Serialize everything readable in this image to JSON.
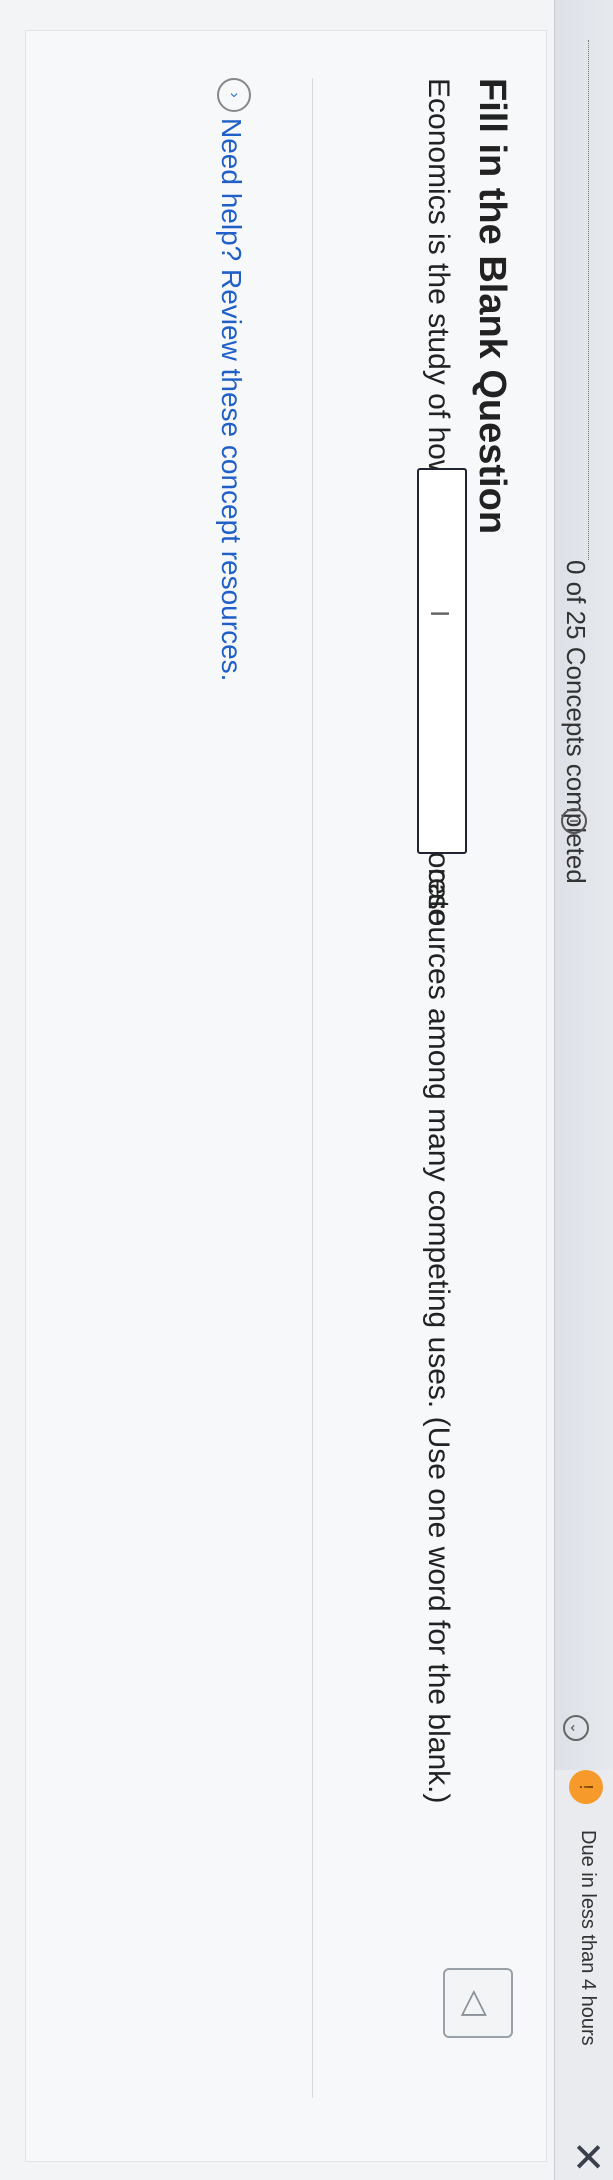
{
  "header": {
    "progress": {
      "fraction": 0.0,
      "label": "0 of 25 Concepts completed"
    },
    "info_icon": "i",
    "chevron_icon": "⌄",
    "due_icon": "!",
    "due_text": "Due in less than 4 hours",
    "close_icon": "✕"
  },
  "question": {
    "title": "Fill in the Blank Question",
    "text_before": "Economics is the study of how individuals and societies allocate",
    "text_after": "resources among many competing uses. (Use one word for the blank.)",
    "blank_value": "",
    "cursor_icon": "I"
  },
  "help": {
    "icon": "›",
    "link_text": "Need help? Review these concept resources."
  },
  "side_button": {
    "icon": "◁"
  },
  "colors": {
    "accent": "#f59a2b",
    "link": "#1f5fc7",
    "text": "#222222"
  }
}
